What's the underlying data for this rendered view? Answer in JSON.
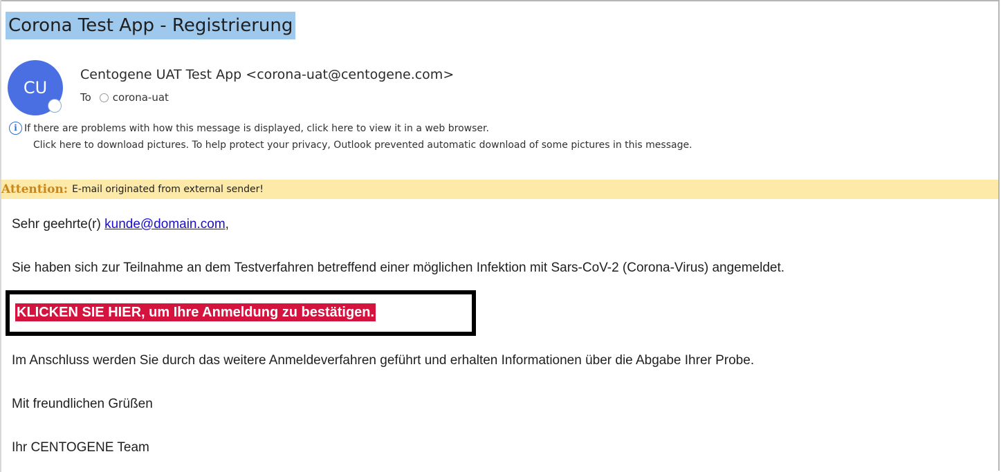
{
  "email": {
    "subject": "Corona Test App - Registrierung",
    "avatar_initials": "CU",
    "sender": "Centogene UAT Test App <corona-uat@centogene.com>",
    "to_label": "To",
    "recipient": "corona-uat",
    "info_line1": "If there are problems with how this message is displayed, click here to view it in a web browser.",
    "info_line2": "Click here to download pictures. To help protect your privacy, Outlook prevented automatic download of some pictures in this message."
  },
  "banner": {
    "label": "Attention:",
    "message": "E-mail originated from external sender!"
  },
  "body": {
    "greeting_prefix": "Sehr geehrte(r) ",
    "greeting_link": "kunde@domain.com",
    "greeting_suffix": ",",
    "paragraph1": "Sie haben sich zur Teilnahme an dem Testverfahren betreffend einer möglichen Infektion mit Sars-CoV-2 (Corona-Virus) angemeldet.",
    "cta": "KLICKEN SIE HIER, um Ihre Anmeldung zu bestätigen.",
    "paragraph2": "Im Anschluss werden Sie durch das weitere Anmeldeverfahren geführt und erhalten Informationen über die Abgabe Ihrer Probe.",
    "closing": "Mit freundlichen Grüßen",
    "signature": "Ihr CENTOGENE Team"
  },
  "colors": {
    "subject_highlight": "#9ec9ed",
    "avatar": "#4a6fe3",
    "banner_bg": "#fde9a8",
    "banner_label": "#c8861d",
    "cta_bg": "#d4143e",
    "link": "#1a0dcc"
  }
}
